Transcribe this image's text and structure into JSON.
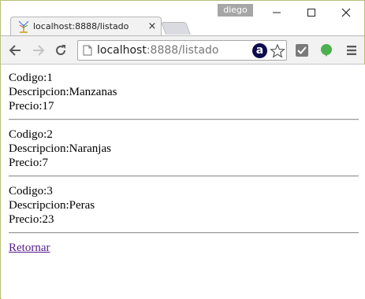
{
  "window": {
    "user": "diego"
  },
  "tab": {
    "title": "localhost:8888/listado",
    "close_glyph": "×"
  },
  "toolbar": {
    "url_host": "localhost",
    "url_rest": ":8888/listado",
    "icons": [
      "back-arrow-icon",
      "forward-arrow-icon",
      "reload-icon",
      "page-icon",
      "amazon-assistant-icon",
      "star-icon",
      "checkmark-extension-icon",
      "evernote-extension-icon",
      "menu-icon"
    ]
  },
  "records": [
    {
      "codigo": "Codigo:1",
      "descripcion": "Descripcion:Manzanas",
      "precio": "Precio:17"
    },
    {
      "codigo": "Codigo:2",
      "descripcion": "Descripcion:Naranjas",
      "precio": "Precio:7"
    },
    {
      "codigo": "Codigo:3",
      "descripcion": "Descripcion:Peras",
      "precio": "Precio:23"
    }
  ],
  "link": {
    "retornar": "Retornar"
  },
  "colors": {
    "link_visited": "#551a8b",
    "toolbar_bg": "#f2f2f2",
    "user_badge_bg": "#a6a6a6"
  }
}
